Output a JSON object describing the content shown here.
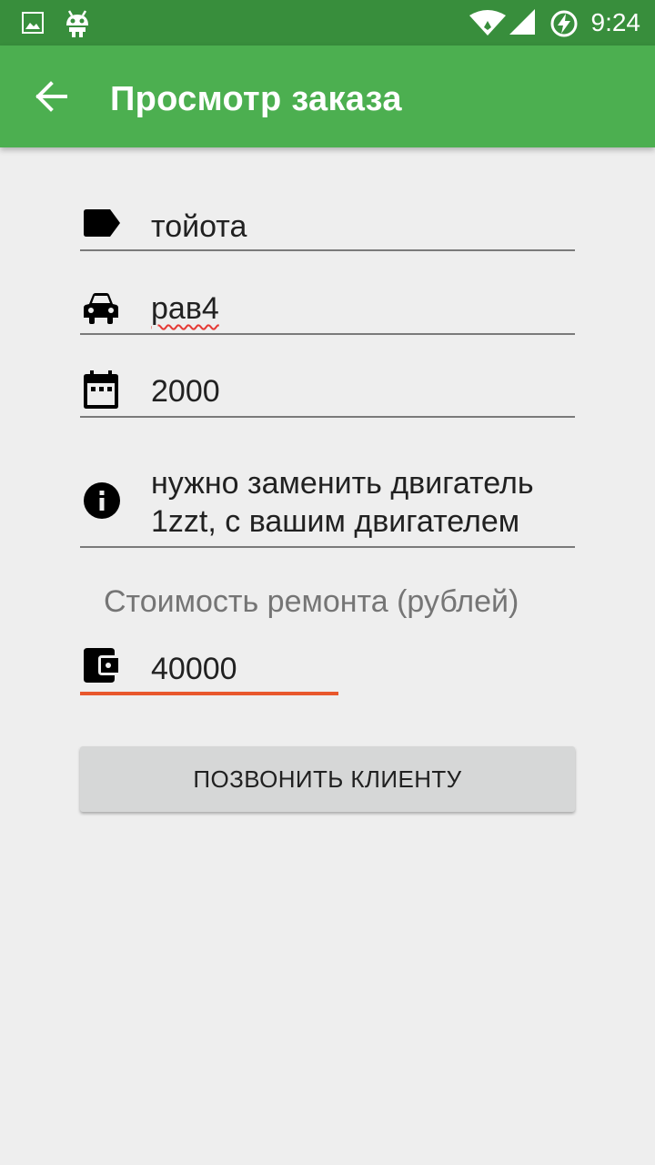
{
  "status_bar": {
    "time": "9:24",
    "icons": [
      "image-icon",
      "cyanogenmod-icon",
      "wifi-icon",
      "signal-icon",
      "battery-charging-icon"
    ]
  },
  "app_bar": {
    "title": "Просмотр заказа",
    "back_icon": "arrow-back-icon"
  },
  "form": {
    "brand": {
      "icon": "label-icon",
      "value": "тойота"
    },
    "model": {
      "icon": "car-icon",
      "value": "рав4"
    },
    "year": {
      "icon": "calendar-icon",
      "value": "2000"
    },
    "description": {
      "icon": "info-icon",
      "line1": "нужно заменить двигатель",
      "line2": "1zzt, с вашим двигателем"
    },
    "cost": {
      "label": "Стоимость ремонта (рублей)",
      "icon": "wallet-icon",
      "value": "40000"
    }
  },
  "actions": {
    "call_label": "ПОЗВОНИТЬ КЛИЕНТУ"
  },
  "colors": {
    "status_bar": "#388e3c",
    "app_bar": "#4caf50",
    "background": "#eeeeee",
    "focus_underline": "#e8572c",
    "button": "#d6d7d7"
  }
}
